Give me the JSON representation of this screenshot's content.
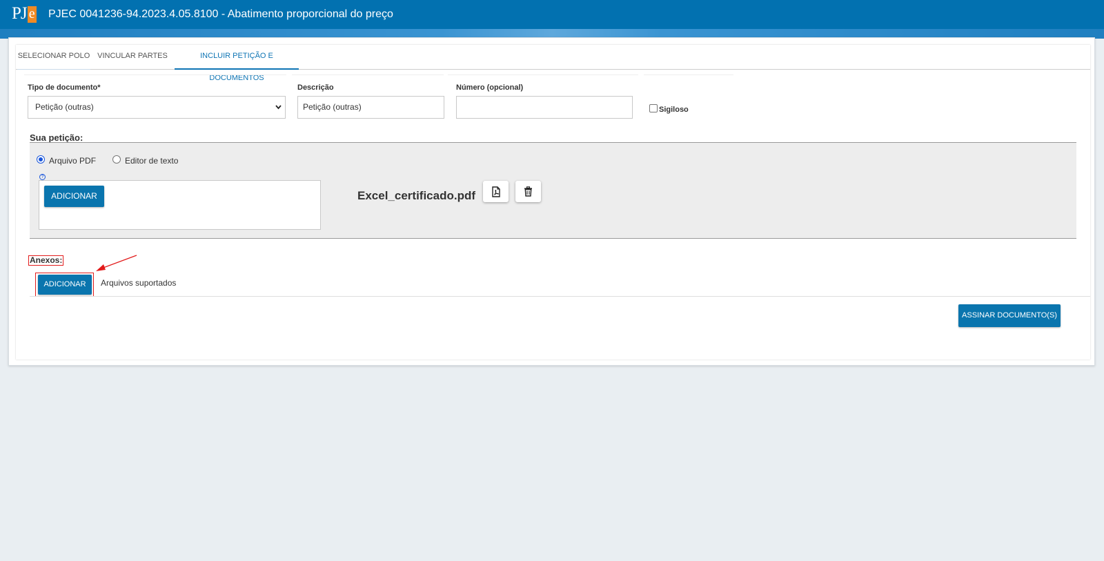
{
  "header": {
    "logo_text": "PJ",
    "logo_e": "e",
    "title": "PJEC 0041236-94.2023.4.05.8100 - Abatimento proporcional do preço"
  },
  "tabs": [
    {
      "label": "SELECIONAR POLO"
    },
    {
      "label": "VINCULAR PARTES"
    },
    {
      "label": "INCLUIR PETIÇÃO E DOCUMENTOS"
    }
  ],
  "form": {
    "tipo_label": "Tipo de documento*",
    "tipo_value": "Petição (outras)",
    "descricao_label": "Descrição",
    "descricao_value": "Petição (outras)",
    "numero_label": "Número (opcional)",
    "numero_value": "",
    "sigiloso_label": "Sigiloso"
  },
  "peticao": {
    "title": "Sua petição:",
    "option_pdf": "Arquivo PDF",
    "option_editor": "Editor de texto",
    "help": "?",
    "add_button": "ADICIONAR",
    "file_name": "Excel_certificado.pdf"
  },
  "anexos": {
    "title": "Anexos:",
    "add_button": "ADICIONAR",
    "supported_link": "Arquivos suportados"
  },
  "actions": {
    "sign_button": "ASSINAR DOCUMENTO(S)"
  },
  "colors": {
    "header": "#0271b0",
    "primary_button": "#0a75ae",
    "annotation": "#e21b1b"
  }
}
